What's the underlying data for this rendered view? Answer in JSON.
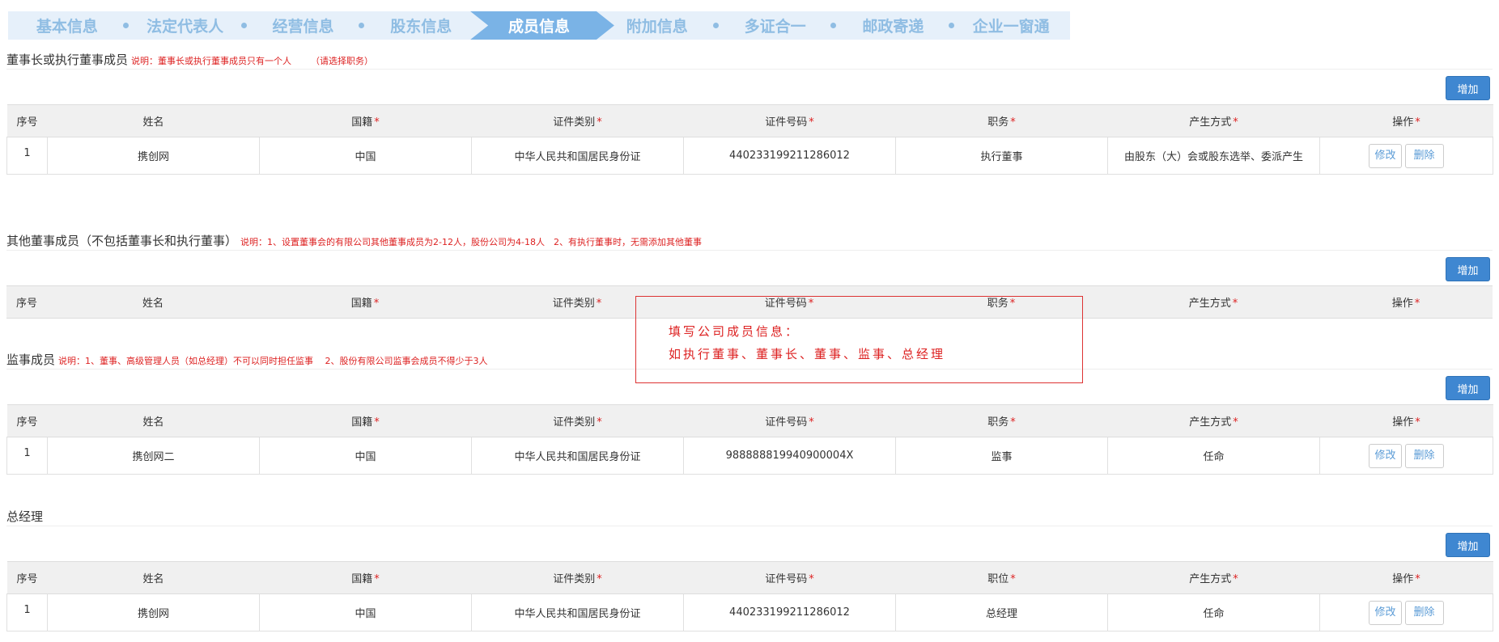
{
  "steps": [
    {
      "label": "基本信息"
    },
    {
      "label": "法定代表人"
    },
    {
      "label": "经营信息"
    },
    {
      "label": "股东信息"
    },
    {
      "label": "成员信息"
    },
    {
      "label": "附加信息"
    },
    {
      "label": "多证合一"
    },
    {
      "label": "邮政寄递"
    },
    {
      "label": "企业一窗通"
    }
  ],
  "active_step": "成员信息",
  "add_label": "增加",
  "edit_label": "修改",
  "delete_label": "删除",
  "required_mark": "*",
  "sections": {
    "chairman": {
      "title": "董事长或执行董事成员",
      "note": "说明：董事长或执行董事成员只有一个人",
      "note2": "（请选择职务）",
      "headers": [
        "序号",
        "姓名",
        "国籍",
        "证件类别",
        "证件号码",
        "职务",
        "产生方式",
        "操作"
      ],
      "rows": [
        {
          "idx": "1",
          "name": "携创网",
          "nationality": "中国",
          "id_type": "中华人民共和国居民身份证",
          "id_no": "440233199211286012",
          "position": "执行董事",
          "method": "由股东（大）会或股东选举、委派产生"
        }
      ]
    },
    "directors": {
      "title": "其他董事成员（不包括董事长和执行董事）",
      "note": "说明：1、设置董事会的有限公司其他董事成员为2-12人，股份公司为4-18人　2、有执行董事时，无需添加其他董事",
      "headers": [
        "序号",
        "姓名",
        "国籍",
        "证件类别",
        "证件号码",
        "职务",
        "产生方式",
        "操作"
      ]
    },
    "supervisors": {
      "title": "监事成员",
      "note": "说明：1、董事、高级管理人员（如总经理）不可以同时担任监事　 2、股份有限公司监事会成员不得少于3人",
      "headers": [
        "序号",
        "姓名",
        "国籍",
        "证件类别",
        "证件号码",
        "职务",
        "产生方式",
        "操作"
      ],
      "rows": [
        {
          "idx": "1",
          "name": "携创网二",
          "nationality": "中国",
          "id_type": "中华人民共和国居民身份证",
          "id_no": "988888819940900004X",
          "position": "监事",
          "method": "任命"
        }
      ]
    },
    "manager": {
      "title": "总经理",
      "headers": [
        "序号",
        "姓名",
        "国籍",
        "证件类别",
        "证件号码",
        "职位",
        "产生方式",
        "操作"
      ],
      "rows": [
        {
          "idx": "1",
          "name": "携创网",
          "nationality": "中国",
          "id_type": "中华人民共和国居民身份证",
          "id_no": "440233199211286012",
          "position": "总经理",
          "method": "任命"
        }
      ]
    }
  },
  "annotation": {
    "line1": "填写公司成员信息：",
    "line2": "如执行董事、董事长、董事、监事、总经理"
  }
}
